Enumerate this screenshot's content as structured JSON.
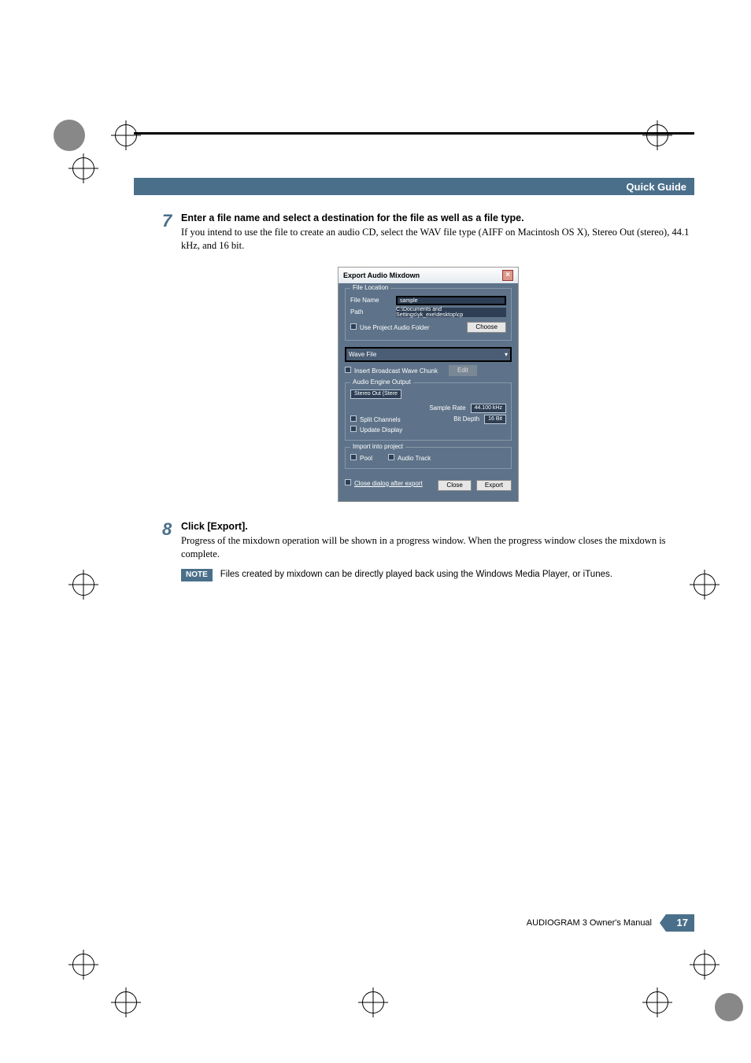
{
  "header": {
    "guide_label": "Quick Guide"
  },
  "step7": {
    "num": "7",
    "heading": "Enter a file name and select a destination for the file as well as a file type.",
    "body": "If you intend to use the file to create an audio CD, select the WAV file type (AIFF on Macintosh OS X), Stereo Out (stereo), 44.1 kHz, and 16 bit."
  },
  "dialog": {
    "title": "Export Audio Mixdown",
    "close_icon": "×",
    "file_location": {
      "legend": "File Location",
      "file_name_label": "File Name",
      "file_name_value": "sample",
      "path_label": "Path",
      "path_value": "C:\\Documents and Settings\\yk_exe\\desktop\\cp",
      "use_project_folder": "Use Project Audio Folder",
      "choose_btn": "Choose"
    },
    "file_format": {
      "select_value": "Wave File",
      "insert_bwf": "Insert Broadcast Wave Chunk",
      "edit_btn": "Edit"
    },
    "engine_output": {
      "legend": "Audio Engine Output",
      "stereo_out": "Stereo Out (Stere",
      "sample_rate_label": "Sample Rate",
      "sample_rate_value": "44.100 kHz",
      "bit_depth_label": "Bit Depth",
      "bit_depth_value": "16 Bit",
      "split_channels": "Split Channels",
      "update_display": "Update Display"
    },
    "import": {
      "legend": "Import into project",
      "pool": "Pool",
      "audio_track": "Audio Track"
    },
    "close_after": "Close dialog after export",
    "close_btn": "Close",
    "export_btn": "Export"
  },
  "step8": {
    "num": "8",
    "heading": "Click [Export].",
    "body": "Progress of the mixdown operation will be shown in a progress window. When the progress window closes the mixdown is complete."
  },
  "note": {
    "label": "NOTE",
    "text": "Files created by mixdown can be directly played back using the Windows Media Player, or iTunes."
  },
  "footer": {
    "manual": "AUDIOGRAM 3 Owner's Manual",
    "page": "17"
  }
}
